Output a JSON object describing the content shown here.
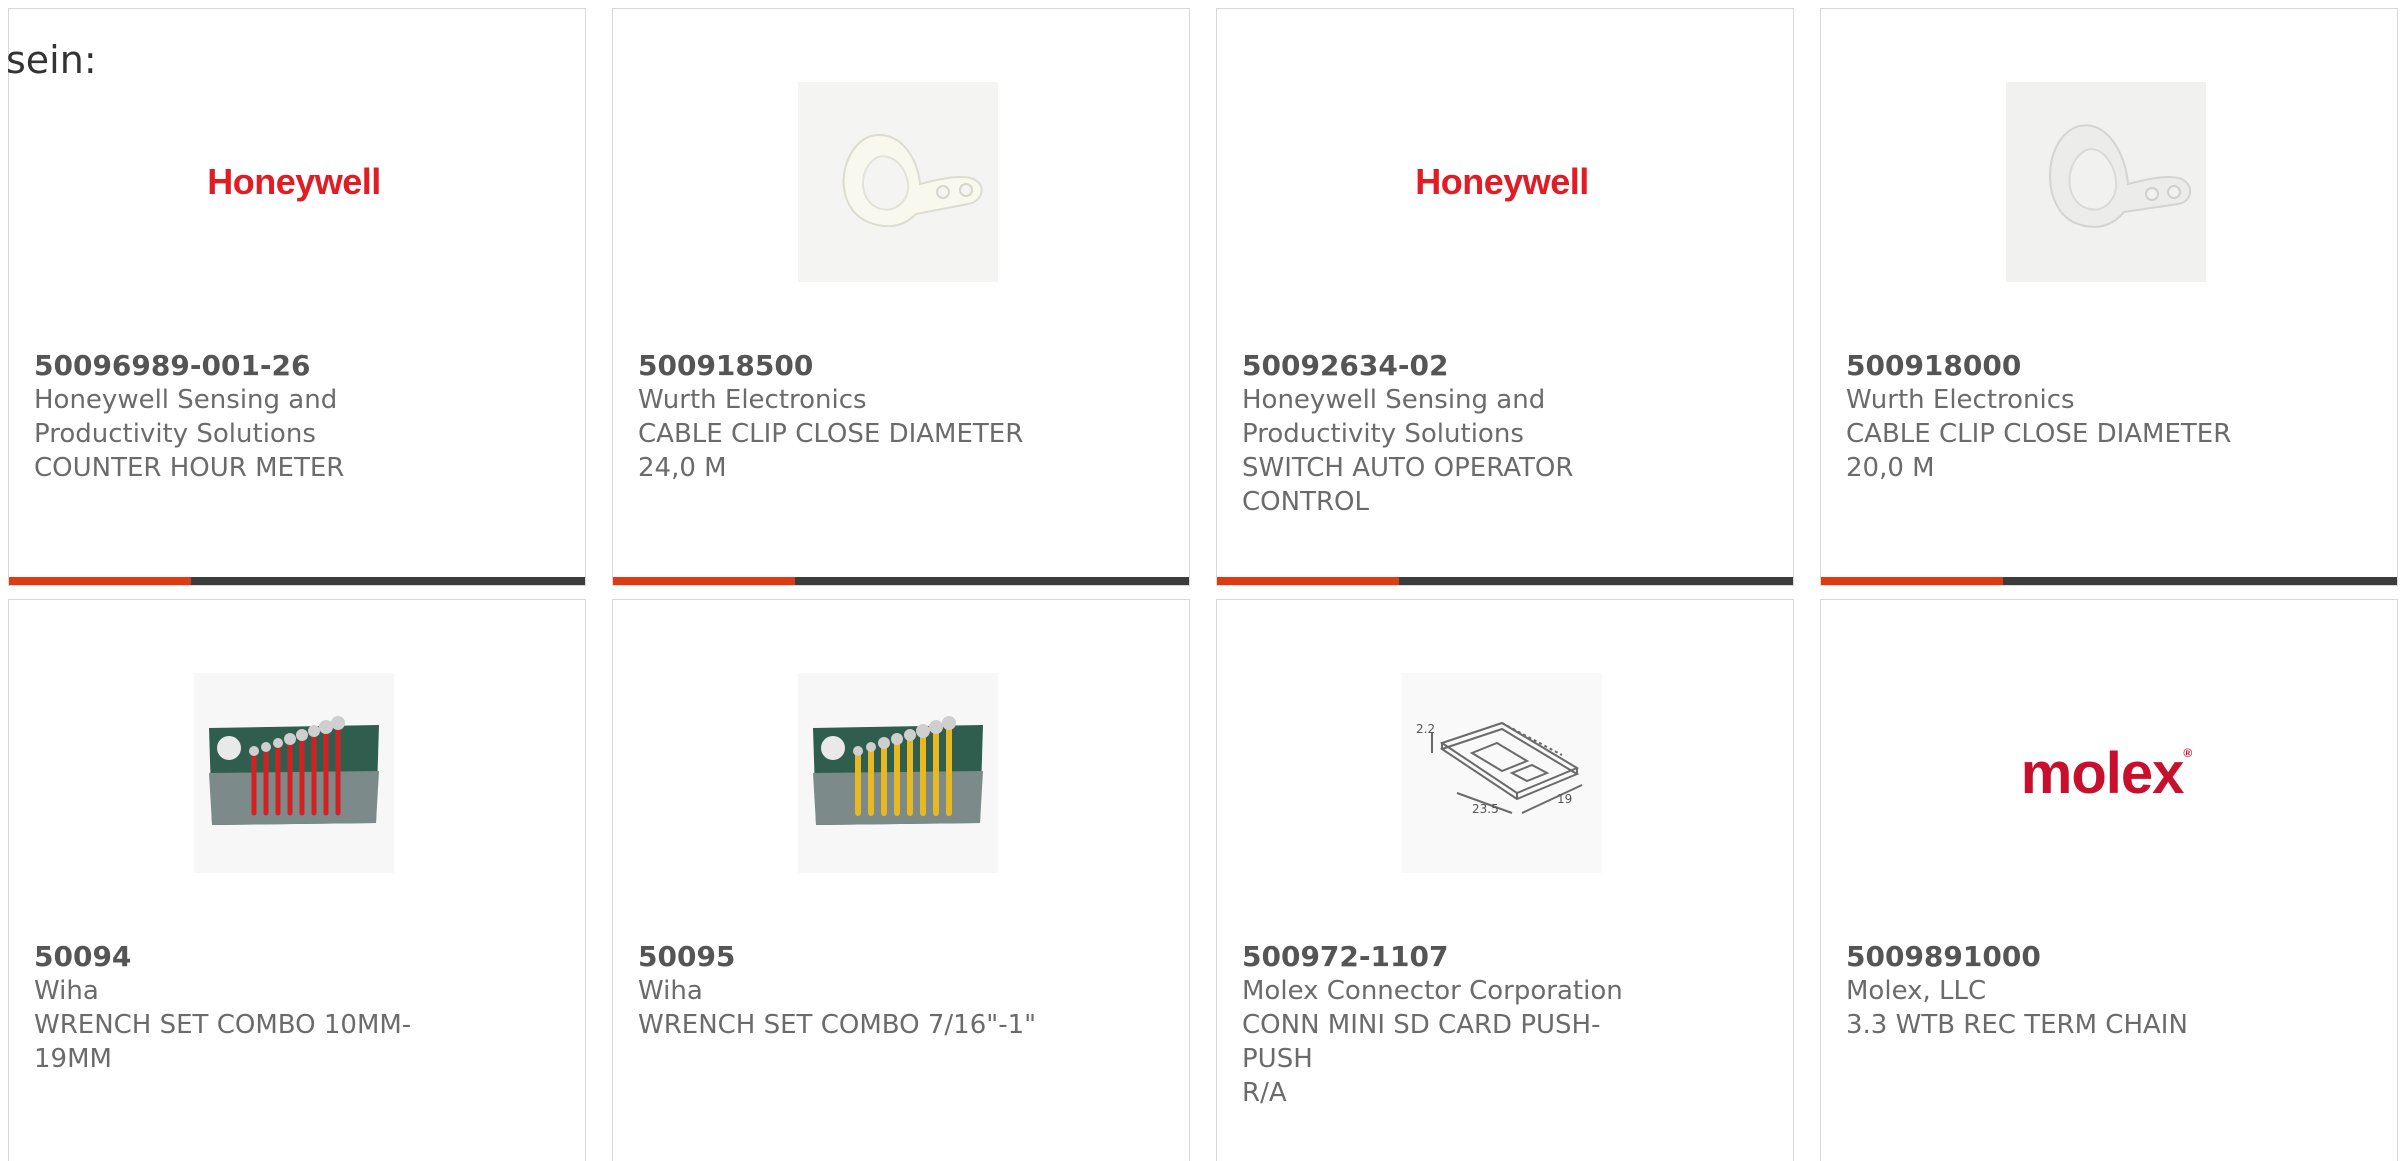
{
  "intro_text": "sein:",
  "colors": {
    "accent": "#e03a12",
    "bar": "#3c3c3c",
    "honeywell_red": "#e31b23",
    "molex_red": "#c8102e"
  },
  "products": [
    {
      "part_number": "50096989-001-26",
      "manufacturer_line1": "Honeywell Sensing and",
      "manufacturer_line2": "Productivity Solutions",
      "description_line1": "COUNTER HOUR METER",
      "description_line2": "",
      "image": "honeywell-logo",
      "logo_text": "Honeywell"
    },
    {
      "part_number": "500918500",
      "manufacturer_line1": "Wurth Electronics",
      "manufacturer_line2": "",
      "description_line1": "CABLE CLIP CLOSE DIAMETER",
      "description_line2": "24,0 M",
      "image": "cable-clip-photo",
      "logo_text": ""
    },
    {
      "part_number": "50092634-02",
      "manufacturer_line1": "Honeywell Sensing and",
      "manufacturer_line2": "Productivity Solutions",
      "description_line1": "SWITCH AUTO OPERATOR",
      "description_line2": "CONTROL",
      "image": "honeywell-logo",
      "logo_text": "Honeywell"
    },
    {
      "part_number": "500918000",
      "manufacturer_line1": "Wurth Electronics",
      "manufacturer_line2": "",
      "description_line1": "CABLE CLIP CLOSE DIAMETER",
      "description_line2": "20,0 M",
      "image": "cable-clip-photo",
      "logo_text": ""
    },
    {
      "part_number": "50094",
      "manufacturer_line1": "Wiha",
      "manufacturer_line2": "",
      "description_line1": "WRENCH SET COMBO 10MM-",
      "description_line2": "19MM",
      "image": "wrench-set-red-photo",
      "logo_text": ""
    },
    {
      "part_number": "50095",
      "manufacturer_line1": "Wiha",
      "manufacturer_line2": "",
      "description_line1": "WRENCH SET COMBO 7/16\"-1\"",
      "description_line2": "",
      "image": "wrench-set-yellow-photo",
      "logo_text": ""
    },
    {
      "part_number": "500972-1107",
      "manufacturer_line1": "Molex Connector Corporation",
      "manufacturer_line2": "",
      "description_line1": "CONN MINI SD CARD PUSH-PUSH",
      "description_line2": "R/A",
      "image": "sd-card-connector-drawing",
      "logo_text": ""
    },
    {
      "part_number": "5009891000",
      "manufacturer_line1": "Molex, LLC",
      "manufacturer_line2": "",
      "description_line1": "3.3 WTB REC TERM CHAIN",
      "description_line2": "",
      "image": "molex-logo",
      "logo_text": "molex"
    }
  ],
  "drawing_labels": {
    "dim1": "2.2",
    "dim2": "23.5",
    "dim3": "19"
  }
}
